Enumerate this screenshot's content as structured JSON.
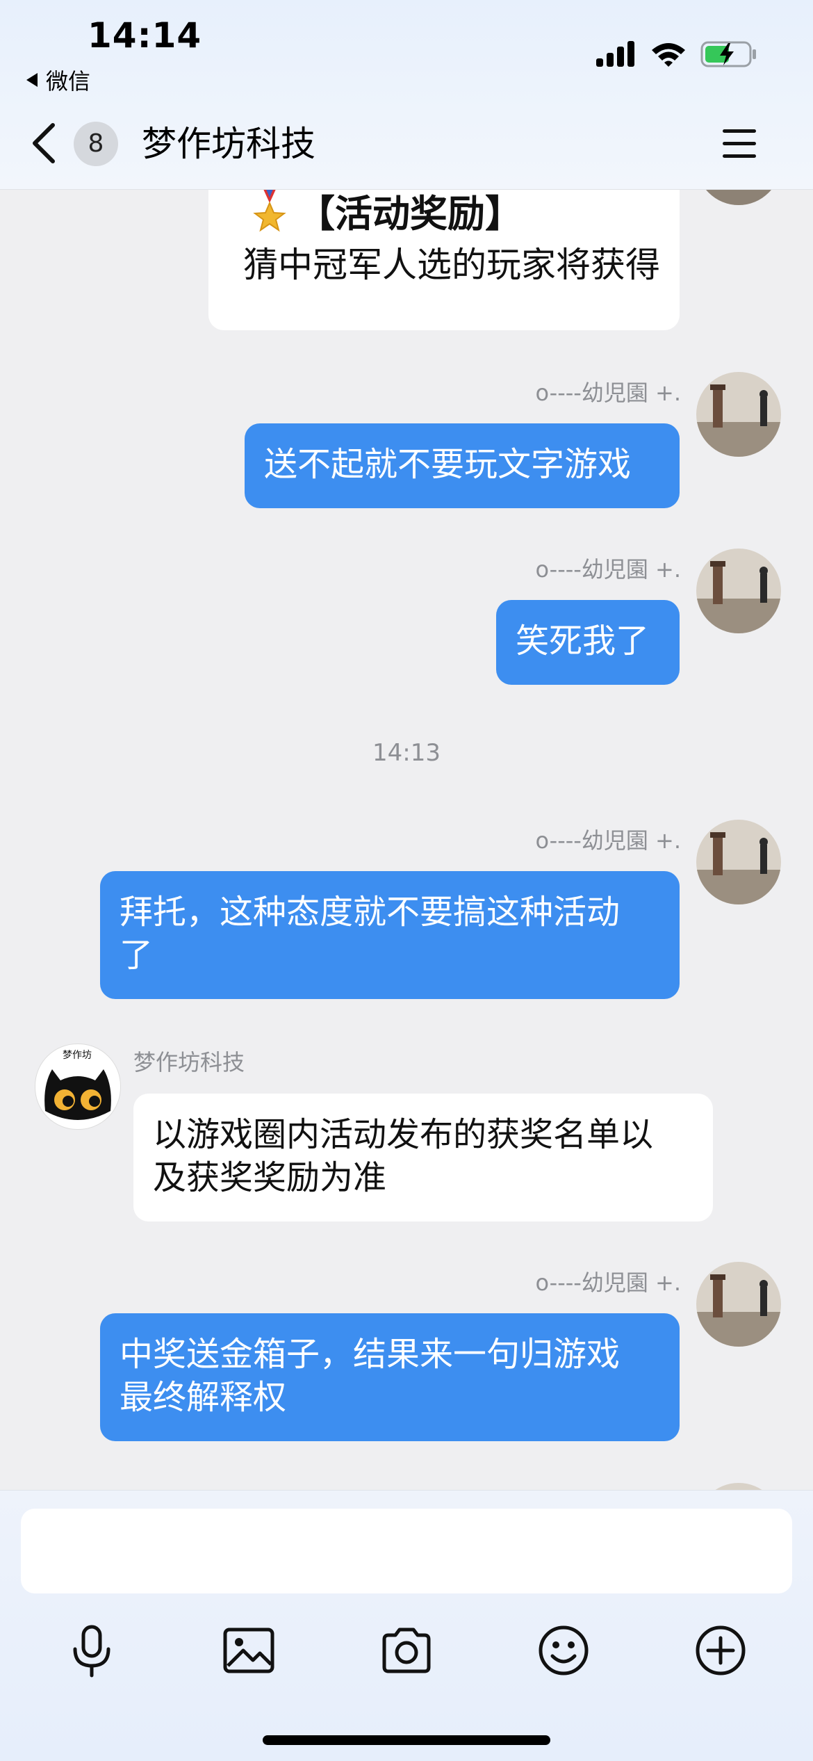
{
  "status_bar": {
    "time": "14:14",
    "back_app": "微信"
  },
  "nav": {
    "unread_count": "8",
    "title": "梦作坊科技"
  },
  "messages": [
    {
      "type": "card",
      "side": "them",
      "title": "【活动奖励】",
      "body": "猜中冠军人选的玩家将获得"
    },
    {
      "type": "text",
      "side": "me",
      "sender": "o----幼児園 +.",
      "text": "送不起就不要玩文字游戏"
    },
    {
      "type": "text",
      "side": "me",
      "sender": "o----幼児園 +.",
      "text": "笑死我了"
    },
    {
      "type": "time",
      "text": "14:13"
    },
    {
      "type": "text",
      "side": "me",
      "sender": "o----幼児園 +.",
      "text_lines": [
        "拜托，这种态度就不要搞这种活动",
        "了"
      ]
    },
    {
      "type": "text",
      "side": "them",
      "sender": "梦作坊科技",
      "text_lines": [
        "以游戏圈内活动发布的获奖名单以",
        "及获奖奖励为准"
      ]
    },
    {
      "type": "text",
      "side": "me",
      "sender": "o----幼児園 +.",
      "text_lines": [
        "中奖送金箱子，结果来一句归游戏",
        "最终解释权"
      ]
    }
  ],
  "group_avatar_text": "梦作坊",
  "input": {
    "placeholder": ""
  },
  "toolbar": {
    "icons": [
      "microphone-icon",
      "image-icon",
      "camera-icon",
      "emoji-icon",
      "plus-icon"
    ]
  },
  "colors": {
    "my_bubble": "#3d8ef0",
    "their_bubble": "#ffffff",
    "background": "#efeff1"
  }
}
